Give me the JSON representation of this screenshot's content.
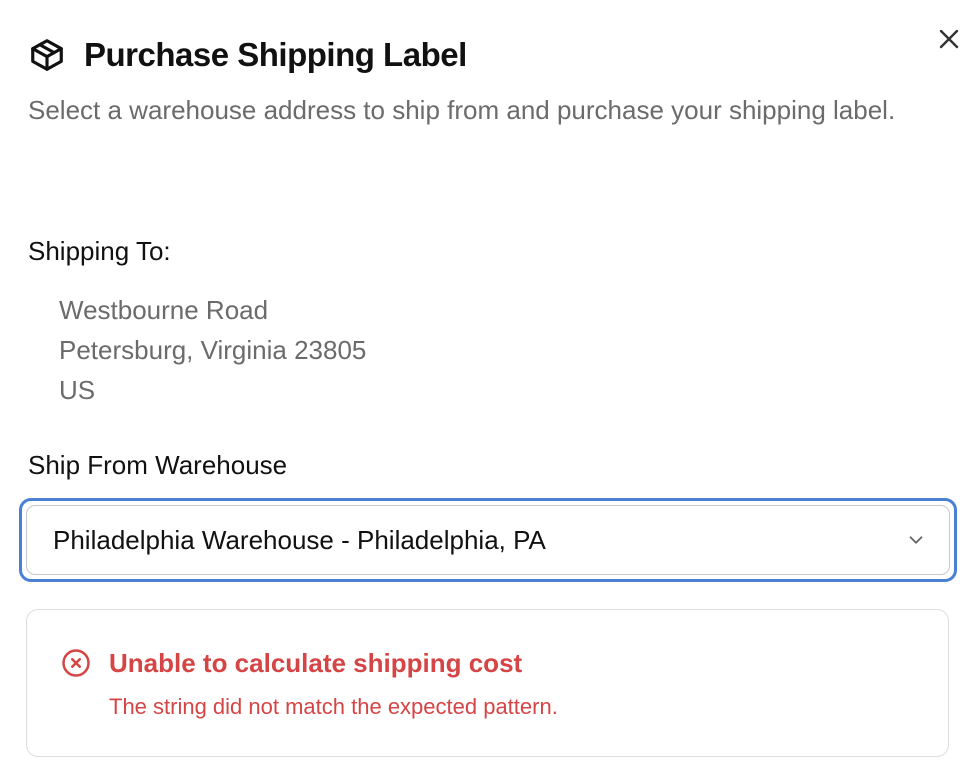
{
  "dialog": {
    "title": "Purchase Shipping Label",
    "subtitle": "Select a warehouse address to ship from and purchase your shipping label.",
    "title_icon": "package-icon",
    "close_icon": "close-icon"
  },
  "shipping_to": {
    "label": "Shipping To:",
    "address_lines": [
      "Westbourne Road",
      "Petersburg, Virginia 23805",
      "US"
    ]
  },
  "warehouse": {
    "label": "Ship From Warehouse",
    "selected": "Philadelphia Warehouse - Philadelphia, PA",
    "dropdown_icon": "chevron-down-icon"
  },
  "error": {
    "icon": "error-circle-x-icon",
    "title": "Unable to calculate shipping cost",
    "message": "The string did not match the expected pattern.",
    "color": "#d64545"
  },
  "colors": {
    "focus_ring": "#4a7fd6",
    "muted_text": "#6b6b6b",
    "primary_text": "#111111"
  }
}
